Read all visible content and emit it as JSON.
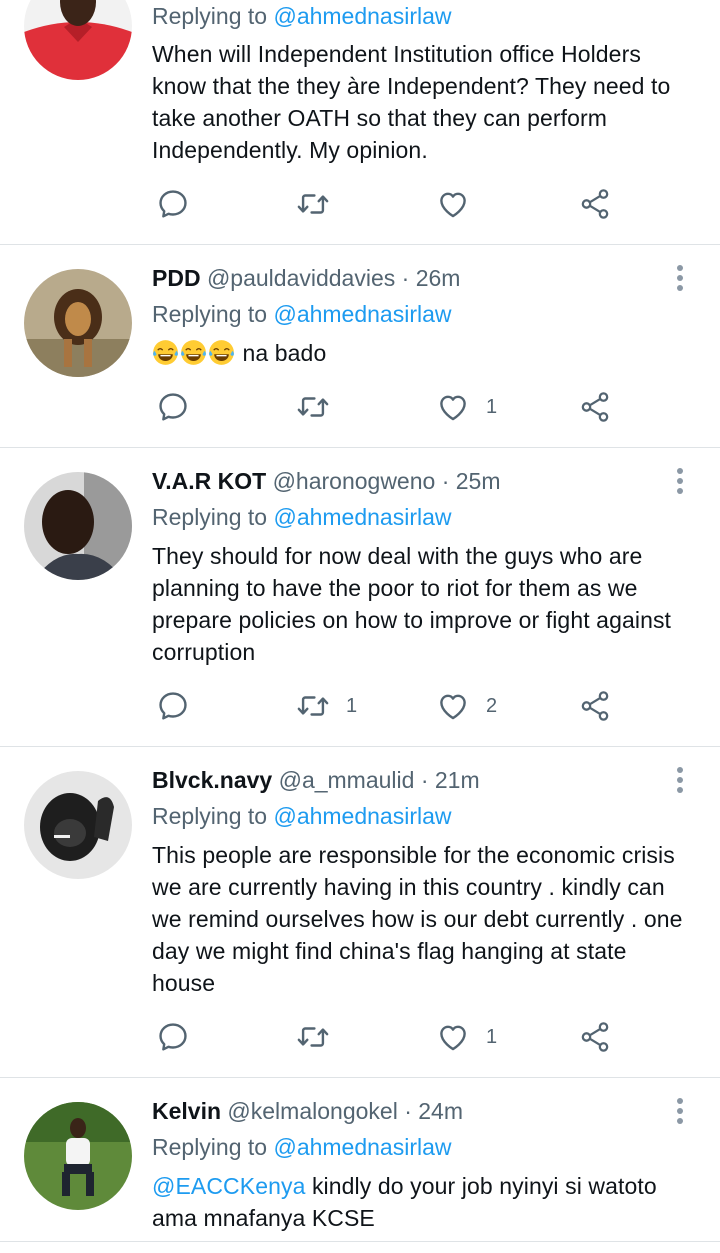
{
  "replying_prefix": "Replying to",
  "tweets": [
    {
      "name": "",
      "handle": "",
      "time": "",
      "replying_to": "@ahmednasirlaw",
      "text": "When will Independent Institution office Holders know that the they àre Independent? They need to take another OATH so that they can perform Independently. My opinion.",
      "replies": "",
      "retweets": "",
      "likes": "",
      "avatar": "person-red-shirt-avatar"
    },
    {
      "name": "PDD",
      "handle": "@pauldaviddavies",
      "dot": "·",
      "time": "26m",
      "replying_to": "@ahmednasirlaw",
      "emoji": "😂😂😂",
      "text": "na bado",
      "retweets": "",
      "likes": "1",
      "avatar": "lion-avatar"
    },
    {
      "name": "V.A.R KOT",
      "handle": "@haronogweno",
      "dot": "·",
      "time": "25m",
      "replying_to": "@ahmednasirlaw",
      "text": "They should for now deal with the guys who are planning to have the poor to riot for them as we prepare policies on how to improve or fight against corruption",
      "retweets": "1",
      "likes": "2",
      "avatar": "man-selfie-avatar"
    },
    {
      "name": "Blvck.navy",
      "handle": "@a_mmaulid",
      "dot": "·",
      "time": "21m",
      "replying_to": "@ahmednasirlaw",
      "text": "This people are responsible for the economic crisis we are currently having in this country . kindly can we remind ourselves how is our debt currently . one day we might find china's flag hanging at state house",
      "retweets": "",
      "likes": "1",
      "avatar": "gorilla-avatar"
    },
    {
      "name": "Kelvin",
      "handle": "@kelmalongokel",
      "dot": "·",
      "time": "24m",
      "replying_to": "@ahmednasirlaw",
      "mention": "@EACCKenya",
      "text": " kindly do your job nyinyi si watoto ama mnafanya KCSE",
      "avatar": "man-sitting-avatar"
    }
  ],
  "icons": {
    "reply": "reply-icon",
    "retweet": "retweet-icon",
    "like": "heart-icon",
    "share": "share-icon",
    "more": "more-icon"
  },
  "colors": {
    "text": "#0f1419",
    "secondary": "#536471",
    "link": "#1d9bf0",
    "divider": "#dfe3e6"
  }
}
